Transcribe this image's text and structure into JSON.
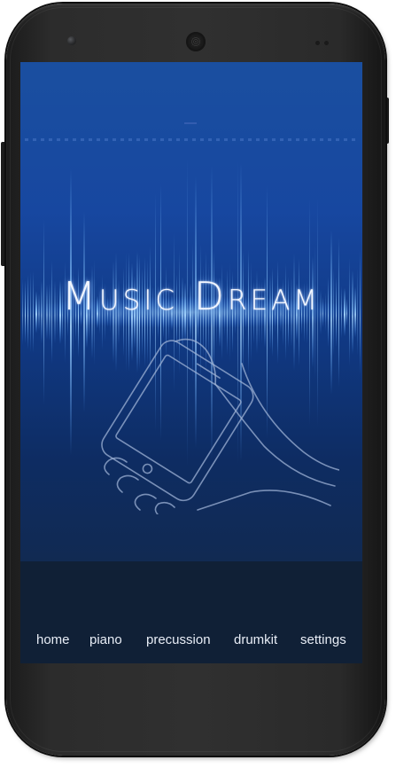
{
  "app": {
    "title": "Music Dream",
    "accent": "#1a4fa0",
    "background": "#102036",
    "text_color": "#e8edf6"
  },
  "hero": {
    "illustration": "hand-holding-phone-icon"
  },
  "nav": {
    "items": [
      {
        "label": "home",
        "icon": "none"
      },
      {
        "label": "piano",
        "icon": "none"
      },
      {
        "label": "precussion",
        "icon": "none"
      },
      {
        "label": "drumkit",
        "icon": "none"
      },
      {
        "label": "settings",
        "icon": "none"
      }
    ]
  }
}
